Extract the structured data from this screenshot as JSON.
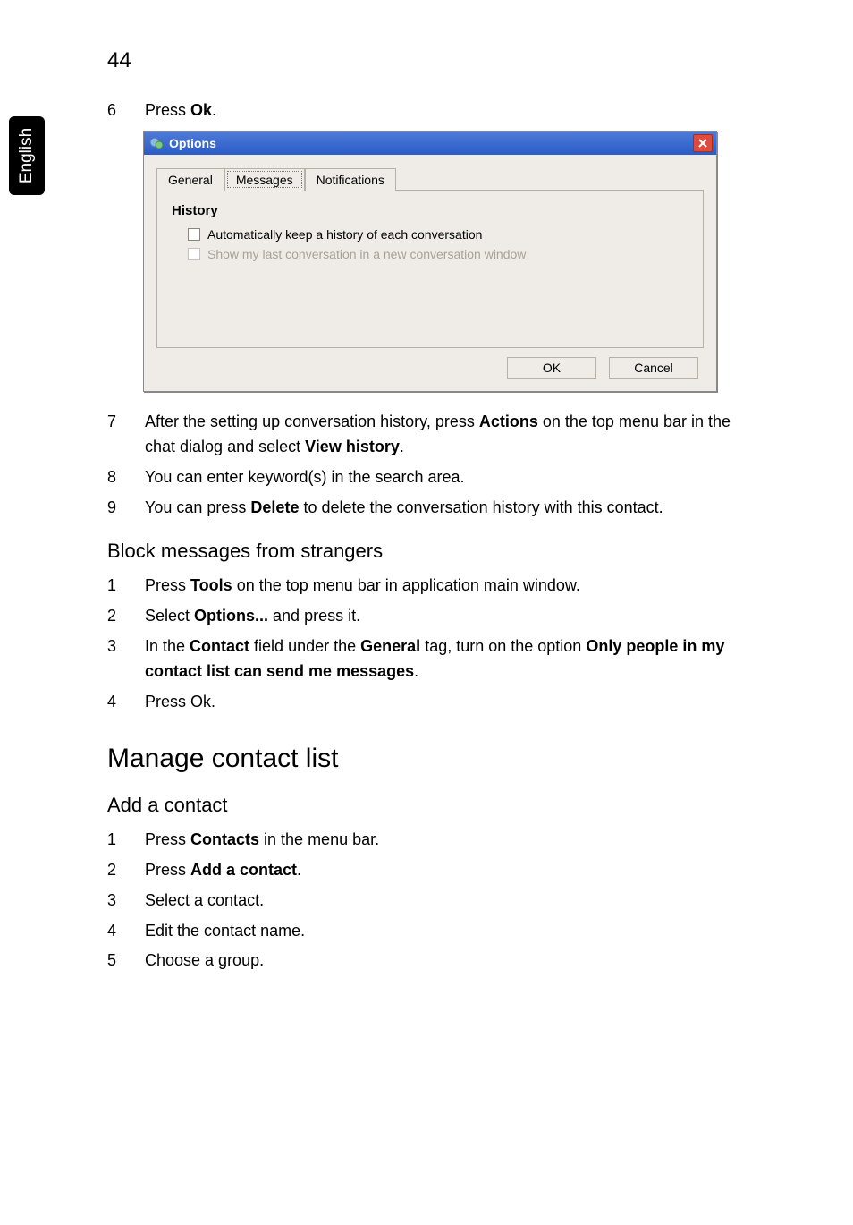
{
  "page_number": "44",
  "side_tab": "English",
  "steps_a": {
    "6": {
      "num": "6",
      "text_a": "Press ",
      "bold_a": "Ok",
      "text_b": "."
    }
  },
  "dialog": {
    "title": "Options",
    "tabs": {
      "general": "General",
      "messages": "Messages",
      "notifications": "Notifications"
    },
    "section": "History",
    "opt1": "Automatically keep a history of each conversation",
    "opt2": "Show my last conversation in a new conversation window",
    "ok": "OK",
    "cancel": "Cancel"
  },
  "steps_b": {
    "7": {
      "num": "7",
      "a": "After the setting up conversation history, press ",
      "b": "Actions",
      "c": " on the top menu bar in the chat dialog and select ",
      "d": "View history",
      "e": "."
    },
    "8": {
      "num": "8",
      "a": "You can enter keyword(s) in the search area."
    },
    "9": {
      "num": "9",
      "a": "You can press ",
      "b": "Delete",
      "c": " to delete the conversation history with this contact."
    }
  },
  "h_block": "Block messages from strangers",
  "steps_c": {
    "1": {
      "num": "1",
      "a": "Press ",
      "b": "Tools",
      "c": " on the top menu bar in application main window."
    },
    "2": {
      "num": "2",
      "a": "Select ",
      "b": "Options...",
      "c": " and press it."
    },
    "3": {
      "num": "3",
      "a": "In the ",
      "b": "Contact",
      "c": " field under the ",
      "d": "General",
      "e": " tag, turn on the option ",
      "f": "Only people in my contact list can send me messages",
      "g": "."
    },
    "4": {
      "num": "4",
      "a": "Press Ok."
    }
  },
  "h_manage": "Manage contact list",
  "h_add": "Add a contact",
  "steps_d": {
    "1": {
      "num": "1",
      "a": "Press ",
      "b": "Contacts",
      "c": " in the menu bar."
    },
    "2": {
      "num": "2",
      "a": "Press ",
      "b": "Add a contact",
      "c": "."
    },
    "3": {
      "num": "3",
      "a": "Select a contact."
    },
    "4": {
      "num": "4",
      "a": "Edit the contact name."
    },
    "5": {
      "num": "5",
      "a": "Choose a group."
    }
  }
}
